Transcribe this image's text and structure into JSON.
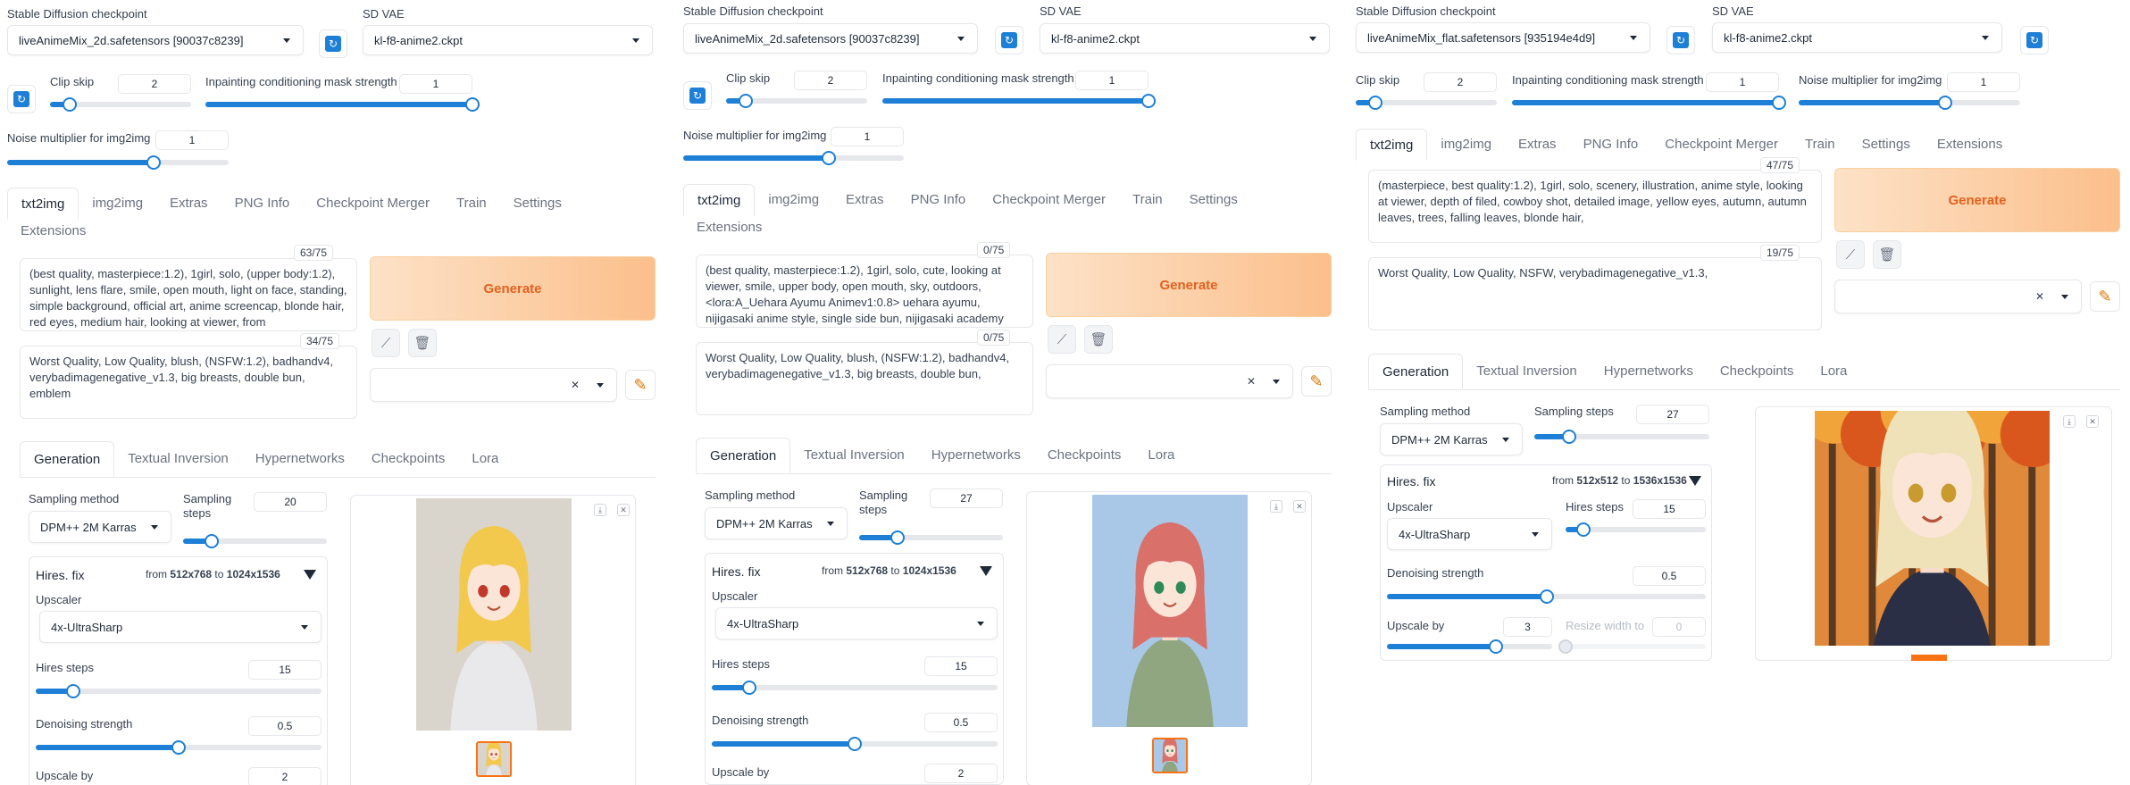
{
  "colors": {
    "accent": "#1e7fd6",
    "generate": "#e2611f",
    "tab_active": "#1f2937"
  },
  "panels": [
    {
      "checkpoint_label": "Stable Diffusion checkpoint",
      "checkpoint_value": "liveAnimeMix_2d.safetensors [90037c8239]",
      "vae_label": "SD VAE",
      "vae_value": "kl-f8-anime2.ckpt",
      "clip_label": "Clip skip",
      "clip_value": "2",
      "clip_fill": 0.14,
      "mask_label": "Inpainting conditioning mask strength",
      "mask_value": "1",
      "mask_fill": 1.0,
      "noise_label": "Noise multiplier for img2img",
      "noise_value": "1",
      "noise_fill": 0.66,
      "tabs": [
        "txt2img",
        "img2img",
        "Extras",
        "PNG Info",
        "Checkpoint Merger",
        "Train",
        "Settings",
        "Extensions"
      ],
      "pos_counter": "63/75",
      "pos_prompt": "(best quality, masterpiece:1.2), 1girl, solo, (upper body:1.2), sunlight, lens flare, smile, open mouth, light on face, standing, simple background,  official art, anime screencap, blonde hair, red eyes, medium hair, looking at viewer, from",
      "neg_counter": "34/75",
      "neg_prompt": "Worst Quality, Low Quality, blush, (NSFW:1.2), badhandv4, verybadimagenegative_v1.3, big breasts, double bun, emblem",
      "generate": "Generate",
      "subtabs": [
        "Generation",
        "Textual Inversion",
        "Hypernetworks",
        "Checkpoints",
        "Lora"
      ],
      "sampling_method_label": "Sampling method",
      "sampling_method": "DPM++ 2M Karras",
      "sampling_steps_label": "Sampling steps",
      "sampling_steps": "20",
      "steps_fill": 0.2,
      "hires_label": "Hires. fix",
      "hires_from": "from",
      "hires_w": "512x768",
      "hires_to": "to",
      "hires_h": "1024x1536",
      "upscaler_label": "Upscaler",
      "upscaler": "4x-UltraSharp",
      "hires_steps_label": "Hires steps",
      "hires_steps": "15",
      "hires_steps_fill": 0.13,
      "denoise_label": "Denoising strength",
      "denoise": "0.5",
      "denoise_fill": 0.5,
      "upscale_label": "Upscale by",
      "upscale": "2",
      "hair": "#f2c94c",
      "eyes": "#c0392b",
      "outfit": "#e9e9ec",
      "bg": "#d9d4cc"
    },
    {
      "checkpoint_label": "Stable Diffusion checkpoint",
      "checkpoint_value": "liveAnimeMix_2d.safetensors [90037c8239]",
      "vae_label": "SD VAE",
      "vae_value": "kl-f8-anime2.ckpt",
      "clip_label": "Clip skip",
      "clip_value": "2",
      "clip_fill": 0.14,
      "mask_label": "Inpainting conditioning mask strength",
      "mask_value": "1",
      "mask_fill": 1.0,
      "noise_label": "Noise multiplier for img2img",
      "noise_value": "1",
      "noise_fill": 0.66,
      "tabs": [
        "txt2img",
        "img2img",
        "Extras",
        "PNG Info",
        "Checkpoint Merger",
        "Train",
        "Settings",
        "Extensions"
      ],
      "pos_counter": "0/75",
      "pos_prompt": "(best quality, masterpiece:1.2), 1girl, solo, cute, looking at viewer, smile, upper body, open mouth, sky, outdoors, <lora:A_Uehara Ayumu Animev1:0.8> uehara ayumu, nijigasaki anime style, single side bun, nijigasaki academy",
      "neg_counter": "0/75",
      "neg_prompt": "Worst Quality, Low Quality, blush, (NSFW:1.2), badhandv4, verybadimagenegative_v1.3, big breasts, double bun,",
      "generate": "Generate",
      "subtabs": [
        "Generation",
        "Textual Inversion",
        "Hypernetworks",
        "Checkpoints",
        "Lora"
      ],
      "sampling_method_label": "Sampling method",
      "sampling_method": "DPM++ 2M Karras",
      "sampling_steps_label": "Sampling steps",
      "sampling_steps": "27",
      "steps_fill": 0.27,
      "hires_label": "Hires. fix",
      "hires_from": "from",
      "hires_w": "512x768",
      "hires_to": "to",
      "hires_h": "1024x1536",
      "upscaler_label": "Upscaler",
      "upscaler": "4x-UltraSharp",
      "hires_steps_label": "Hires steps",
      "hires_steps": "15",
      "hires_steps_fill": 0.13,
      "denoise_label": "Denoising strength",
      "denoise": "0.5",
      "denoise_fill": 0.5,
      "upscale_label": "Upscale by",
      "upscale": "2",
      "hair": "#d9706a",
      "eyes": "#2e8b57",
      "outfit": "#8fa680",
      "bg": "#a9c8e8"
    },
    {
      "checkpoint_label": "Stable Diffusion checkpoint",
      "checkpoint_value": "liveAnimeMix_flat.safetensors [935194e4d9]",
      "vae_label": "SD VAE",
      "vae_value": "kl-f8-anime2.ckpt",
      "clip_label": "Clip skip",
      "clip_value": "2",
      "clip_fill": 0.14,
      "mask_label": "Inpainting conditioning mask strength",
      "mask_value": "1",
      "mask_fill": 1.0,
      "noise_label": "Noise multiplier for img2img",
      "noise_value": "1",
      "noise_fill": 0.66,
      "tabs": [
        "txt2img",
        "img2img",
        "Extras",
        "PNG Info",
        "Checkpoint Merger",
        "Train",
        "Settings",
        "Extensions"
      ],
      "pos_counter": "47/75",
      "pos_prompt": "(masterpiece, best quality:1.2), 1girl, solo, scenery, illustration, anime style, looking at viewer, depth of filed, cowboy shot, detailed image, yellow eyes, autumn, autumn leaves, trees, falling leaves, blonde hair,",
      "neg_counter": "19/75",
      "neg_prompt": "Worst Quality, Low Quality, NSFW, verybadimagenegative_v1.3,",
      "generate": "Generate",
      "subtabs": [
        "Generation",
        "Textual Inversion",
        "Hypernetworks",
        "Checkpoints",
        "Lora"
      ],
      "sampling_method_label": "Sampling method",
      "sampling_method": "DPM++ 2M Karras",
      "sampling_steps_label": "Sampling steps",
      "sampling_steps": "27",
      "steps_fill": 0.2,
      "hires_label": "Hires. fix",
      "hires_from": "from",
      "hires_w": "512x512",
      "hires_to": "to",
      "hires_h": "1536x1536",
      "upscaler_label": "Upscaler",
      "upscaler": "4x-UltraSharp",
      "hires_steps_label": "Hires steps",
      "hires_steps": "15",
      "hires_steps_fill": 0.13,
      "denoise_label": "Denoising strength",
      "denoise": "0.5",
      "denoise_fill": 0.5,
      "upscale_label": "Upscale by",
      "upscale": "3",
      "upscale_fill": 0.66,
      "resize_label": "Resize width to",
      "resize_value": "0",
      "hair": "#efe2b8",
      "eyes": "#c99b2e",
      "outfit": "#2a2f45",
      "bg": "#e0893a"
    }
  ]
}
